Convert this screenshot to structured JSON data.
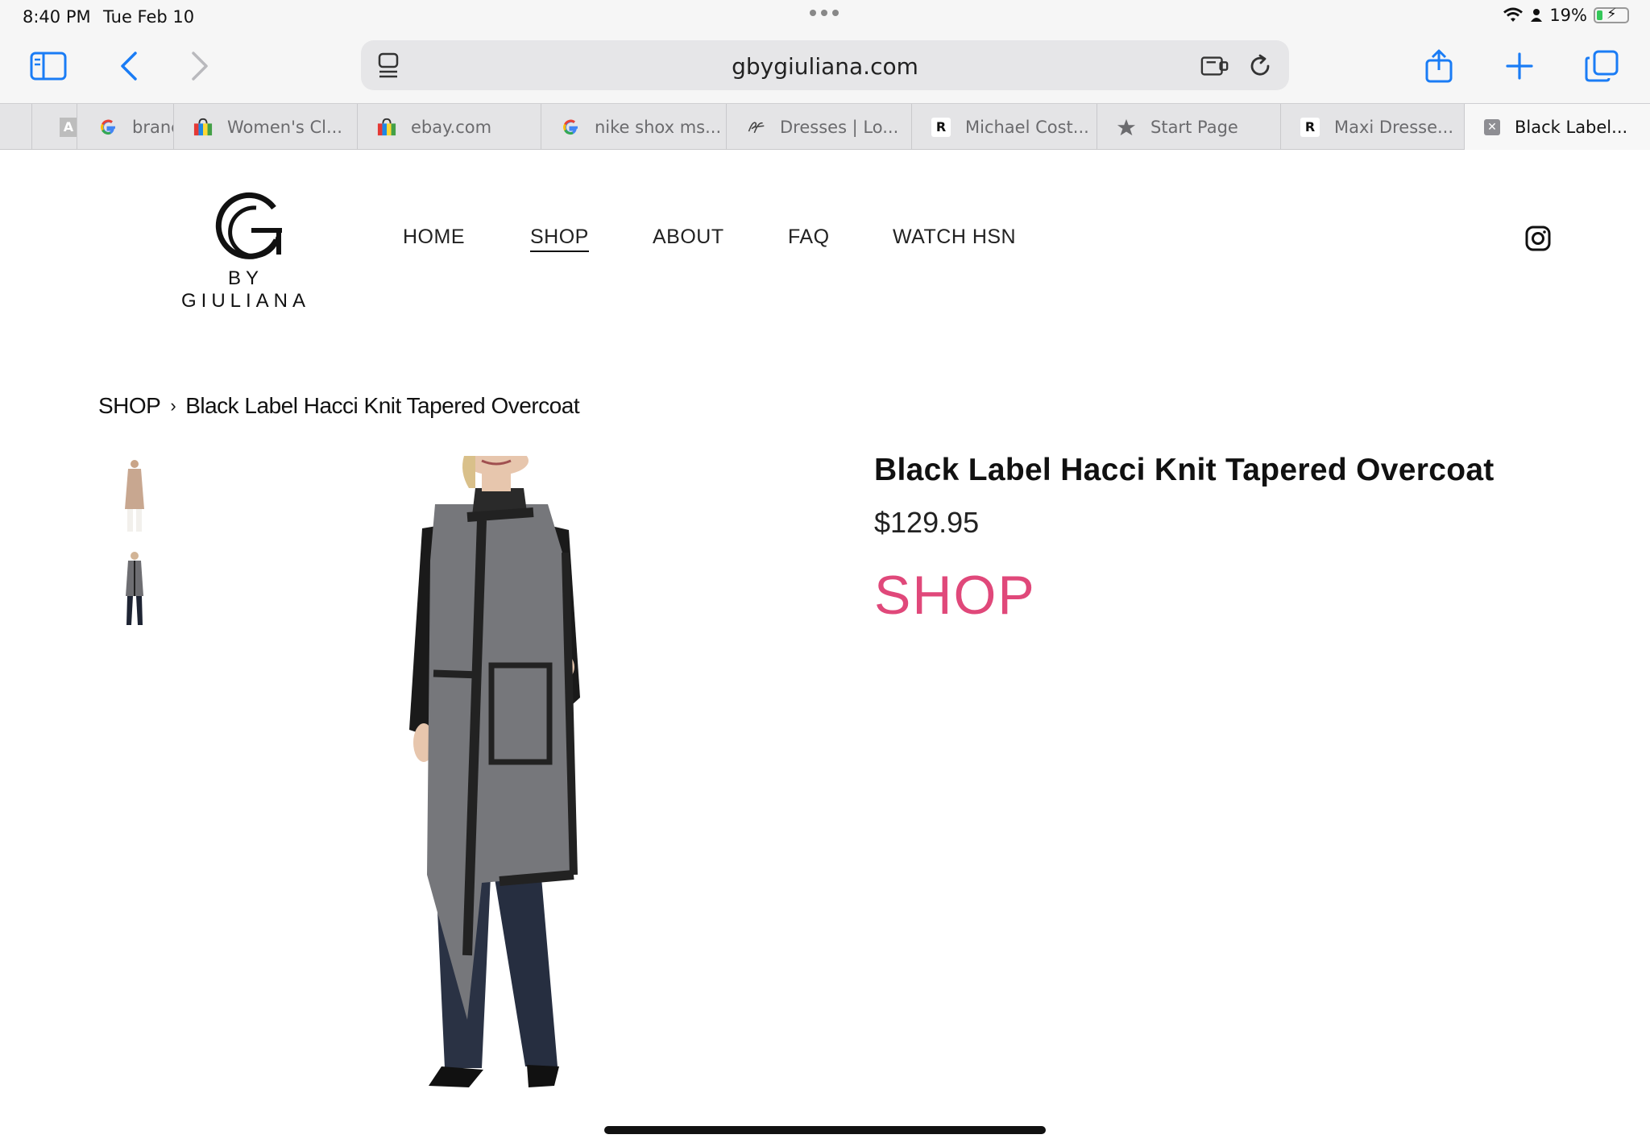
{
  "status_bar": {
    "time": "8:40 PM",
    "date": "Tue Feb 10",
    "battery": "19%",
    "battery_level": 0.19
  },
  "browser": {
    "url": "gbygiuliana.com",
    "tabs": [
      {
        "label": "A",
        "icon": "font-icon"
      },
      {
        "label": "branc",
        "icon": "google-icon"
      },
      {
        "label": "Women's Cl...",
        "icon": "shopping-bag-icon"
      },
      {
        "label": "ebay.com",
        "icon": "shopping-bag-icon"
      },
      {
        "label": "nike shox ms...",
        "icon": "google-icon"
      },
      {
        "label": "Dresses | Lo...",
        "icon": "script-logo-icon"
      },
      {
        "label": "Michael Cost...",
        "icon": "r-logo-icon"
      },
      {
        "label": "Start Page",
        "icon": "star-icon"
      },
      {
        "label": "Maxi Dresse...",
        "icon": "r-logo-icon"
      },
      {
        "label": "Black Label...",
        "icon": "close-icon"
      }
    ]
  },
  "site": {
    "logo_text": "BY GIULIANA",
    "nav": [
      "HOME",
      "SHOP",
      "ABOUT",
      "FAQ",
      "WATCH HSN"
    ],
    "active_nav": "SHOP"
  },
  "breadcrumb": {
    "root": "SHOP",
    "separator": "›",
    "current": "Black Label Hacci Knit Tapered Overcoat"
  },
  "product": {
    "title": "Black Label Hacci Knit Tapered Overcoat",
    "price": "$129.95",
    "cta": "SHOP",
    "cta_color": "#e0487a"
  }
}
